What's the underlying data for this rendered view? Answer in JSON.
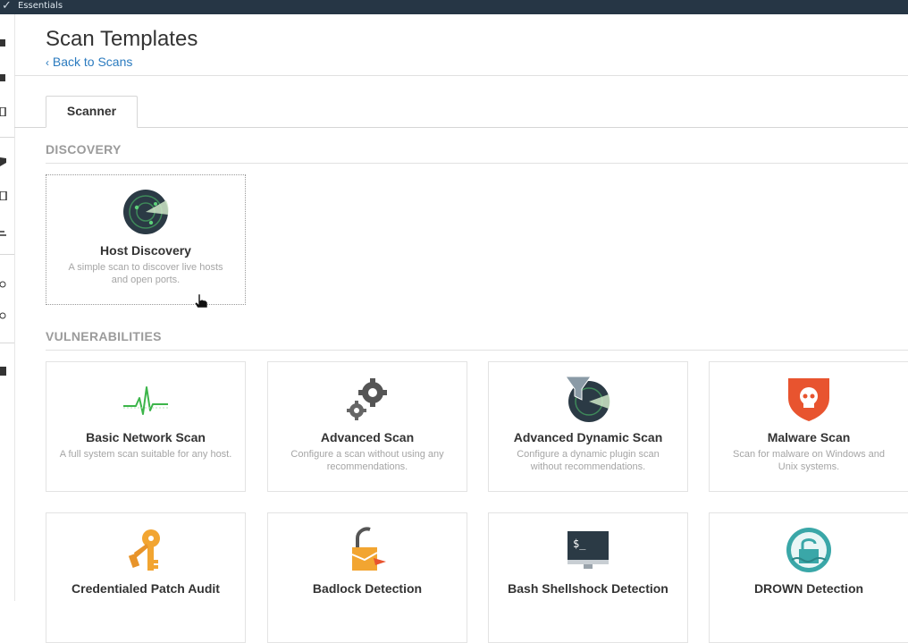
{
  "topbar": {
    "brand": "Essentials"
  },
  "page": {
    "title": "Scan Templates",
    "back_link": "Back to Scans"
  },
  "tabs": [
    {
      "label": "Scanner"
    }
  ],
  "sections": {
    "discovery": "DISCOVERY",
    "vulnerabilities": "VULNERABILITIES"
  },
  "discovery_cards": [
    {
      "name": "Host Discovery",
      "desc": "A simple scan to discover live hosts and open ports.",
      "icon": "radar-icon"
    }
  ],
  "vuln_cards": [
    {
      "name": "Basic Network Scan",
      "desc": "A full system scan suitable for any host.",
      "icon": "pulse-icon"
    },
    {
      "name": "Advanced Scan",
      "desc": "Configure a scan without using any recommendations.",
      "icon": "gears-icon"
    },
    {
      "name": "Advanced Dynamic Scan",
      "desc": "Configure a dynamic plugin scan without recommendations.",
      "icon": "filter-radar-icon"
    },
    {
      "name": "Malware Scan",
      "desc": "Scan for malware on Windows and Unix systems.",
      "icon": "skull-shield-icon"
    },
    {
      "name": "Credentialed Patch Audit",
      "desc": "",
      "icon": "keys-icon"
    },
    {
      "name": "Badlock Detection",
      "desc": "",
      "icon": "broken-lock-icon"
    },
    {
      "name": "Bash Shellshock Detection",
      "desc": "",
      "icon": "terminal-icon"
    },
    {
      "name": "DROWN Detection",
      "desc": "",
      "icon": "drowning-lock-icon"
    }
  ],
  "colors": {
    "topbar": "#263645",
    "link": "#2b7bbf",
    "malware_shield": "#e8542f",
    "key_orange": "#f2a531",
    "drown_teal": "#3aa7a8"
  }
}
